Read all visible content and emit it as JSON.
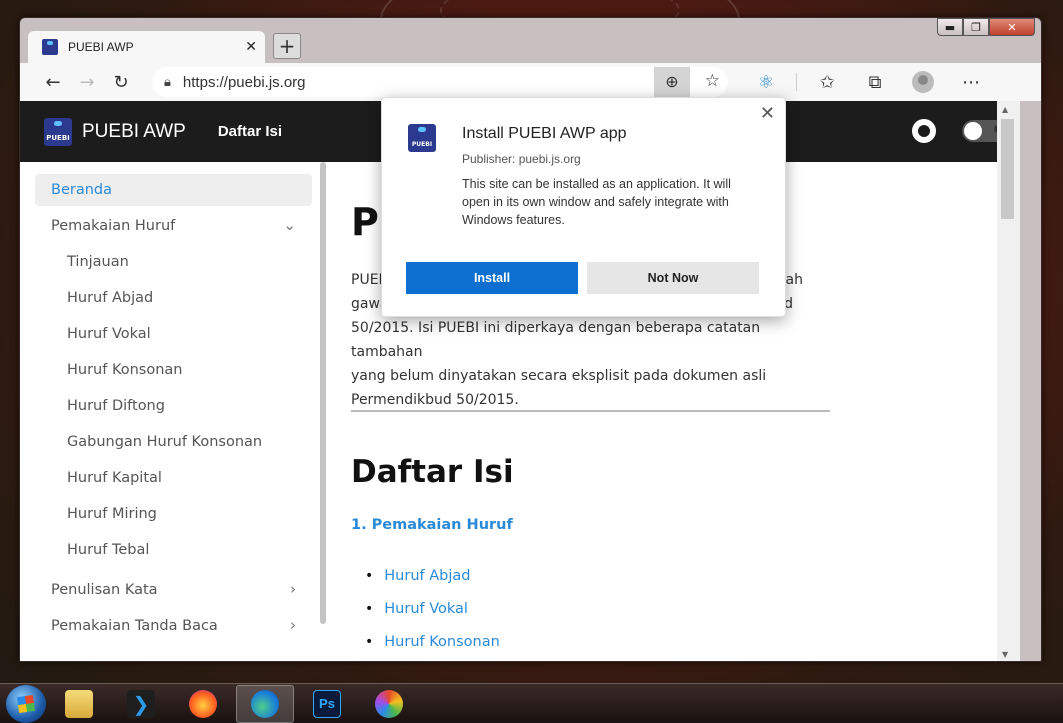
{
  "browser": {
    "tab_title": "PUEBI AWP",
    "tab_close": "✕",
    "new_tab": "+",
    "url": "https://puebi.js.org",
    "window_controls": {
      "minimize": "▬",
      "maximize": "❐",
      "close": "✕"
    }
  },
  "site": {
    "logo_text": "PUEBI",
    "title": "PUEBI AWP",
    "nav_link": "Daftar Isi"
  },
  "sidebar": {
    "items": [
      {
        "label": "Beranda",
        "active": true
      },
      {
        "label": "Pemakaian Huruf",
        "expandable": true,
        "expanded": true
      },
      {
        "label": "Tinjauan",
        "child": true
      },
      {
        "label": "Huruf Abjad",
        "child": true
      },
      {
        "label": "Huruf Vokal",
        "child": true
      },
      {
        "label": "Huruf Konsonan",
        "child": true
      },
      {
        "label": "Huruf Diftong",
        "child": true
      },
      {
        "label": "Gabungan Huruf Konsonan",
        "child": true
      },
      {
        "label": "Huruf Kapital",
        "child": true
      },
      {
        "label": "Huruf Miring",
        "child": true
      },
      {
        "label": "Huruf Tebal",
        "child": true
      },
      {
        "label": "Penulisan Kata",
        "expandable": true
      },
      {
        "label": "Pemakaian Tanda Baca",
        "expandable": true
      }
    ]
  },
  "content": {
    "h1": "PU",
    "para_lines": [
      "PUEB",
      "gawa",
      "50/2015. Isi PUEBI ini diperkaya dengan beberapa catatan tambahan",
      "yang belum dinyatakan secara eksplisit pada dokumen asli",
      "Permendikbud 50/2015."
    ],
    "para_right_fragments": [
      "ah",
      "d"
    ],
    "h2": "Daftar Isi",
    "section_title": "1. Pemakaian Huruf",
    "links": [
      "Huruf Abjad",
      "Huruf Vokal",
      "Huruf Konsonan"
    ]
  },
  "popup": {
    "logo_text": "PUEBI",
    "title": "Install PUEBI AWP app",
    "publisher": "Publisher: puebi.js.org",
    "description": "This site can be installed as an application. It will open in its own window and safely integrate with Windows features.",
    "install_label": "Install",
    "not_now_label": "Not Now",
    "close": "✕"
  },
  "taskbar": {
    "apps": [
      "file-explorer",
      "vscode",
      "firefox",
      "edge",
      "photoshop",
      "paint"
    ],
    "ps_label": "Ps"
  }
}
